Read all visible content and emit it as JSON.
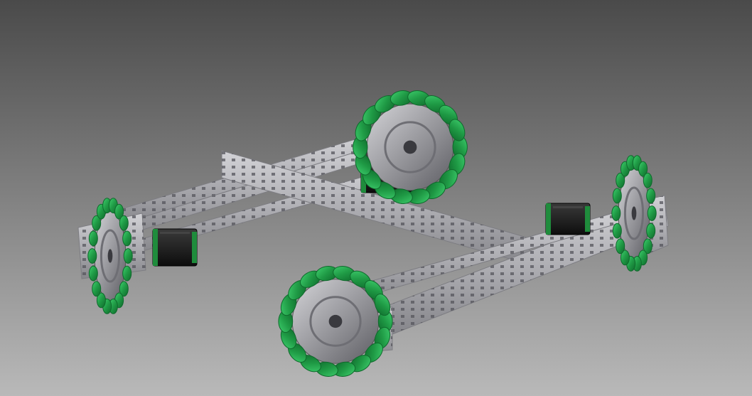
{
  "scene": {
    "description_visible_text": [],
    "background": {
      "top_color": "#4a4a4a",
      "bottom_color": "#b9b9b9"
    },
    "colors": {
      "omni_roller": "#1f9a45",
      "omni_roller_dark": "#0f6a2c",
      "omni_roller_light": "#3fcf6e",
      "hub_metal": "#8d8d92",
      "hub_metal_light": "#c8c8cc",
      "channel_metal": "#b4b4b8",
      "channel_metal_dark": "#7d7d82",
      "channel_hole": "#4e4e54",
      "motor_body": "#1a1a1a",
      "motor_cap": "#1f8c3c"
    },
    "icons": {
      "wheels": [
        "omni-wheel-icon",
        "omni-wheel-icon",
        "omni-wheel-icon",
        "omni-wheel-icon"
      ],
      "motors": [
        "dc-motor-icon",
        "dc-motor-icon",
        "dc-motor-icon",
        "dc-motor-icon"
      ],
      "frame": "aluminum-channel-icon"
    }
  }
}
